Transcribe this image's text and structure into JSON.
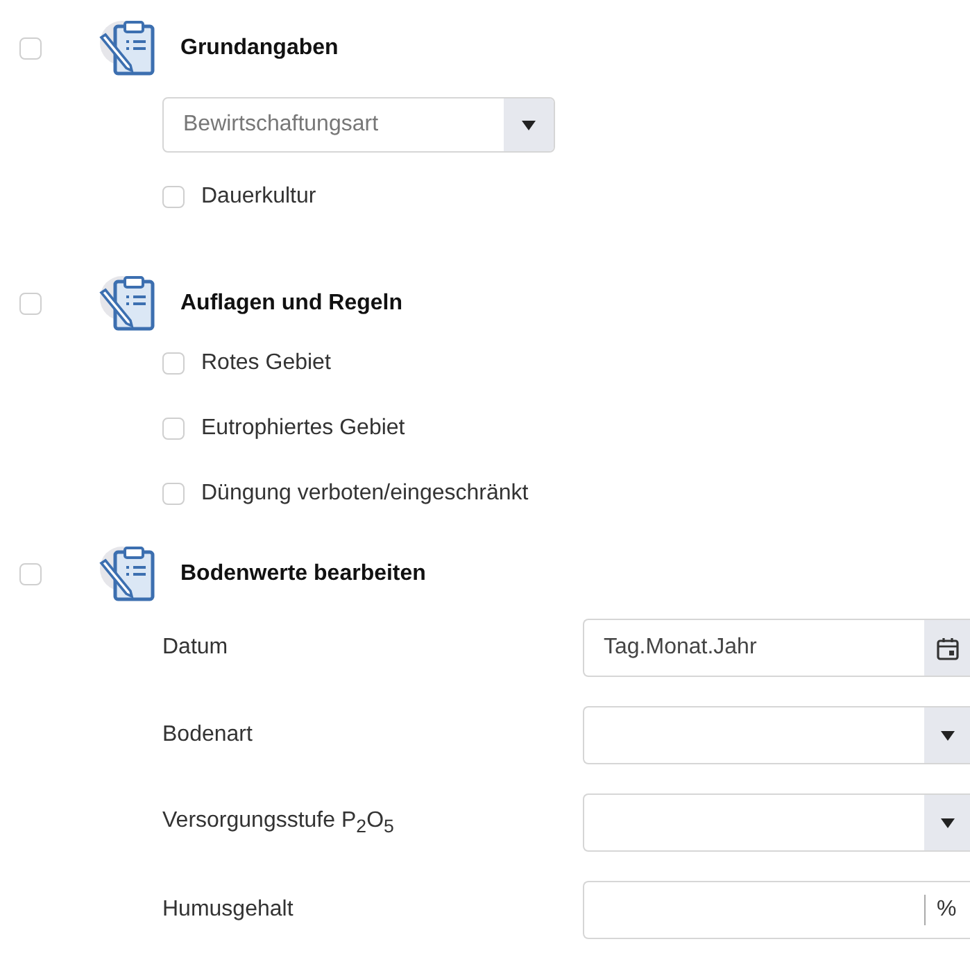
{
  "sections": [
    {
      "title": "Grundangaben",
      "checked": false,
      "items": [
        {
          "kind": "select",
          "placeholder": "Bewirtschaftungsart"
        },
        {
          "kind": "checkbox",
          "label": "Dauerkultur",
          "checked": false
        }
      ]
    },
    {
      "title": "Auflagen und Regeln",
      "checked": false,
      "items": [
        {
          "kind": "checkbox",
          "label": "Rotes Gebiet",
          "checked": false
        },
        {
          "kind": "checkbox",
          "label": "Eutrophiertes Gebiet",
          "checked": false
        },
        {
          "kind": "checkbox",
          "label": "Düngung verboten/eingeschränkt",
          "checked": false
        }
      ]
    },
    {
      "title": "Bodenwerte bearbeiten",
      "checked": false,
      "items": [
        {
          "kind": "field",
          "label": "Datum",
          "field": {
            "kind": "date",
            "placeholder": "Tag.Monat.Jahr"
          }
        },
        {
          "kind": "field",
          "label": "Bodenart",
          "field": {
            "kind": "select"
          }
        },
        {
          "kind": "field",
          "label": "Versorgungsstufe P$_{2}$O$_{5}$",
          "field": {
            "kind": "select"
          }
        },
        {
          "kind": "field",
          "label": "Humusgehalt",
          "field": {
            "kind": "unit",
            "unit": "%"
          }
        }
      ]
    }
  ]
}
